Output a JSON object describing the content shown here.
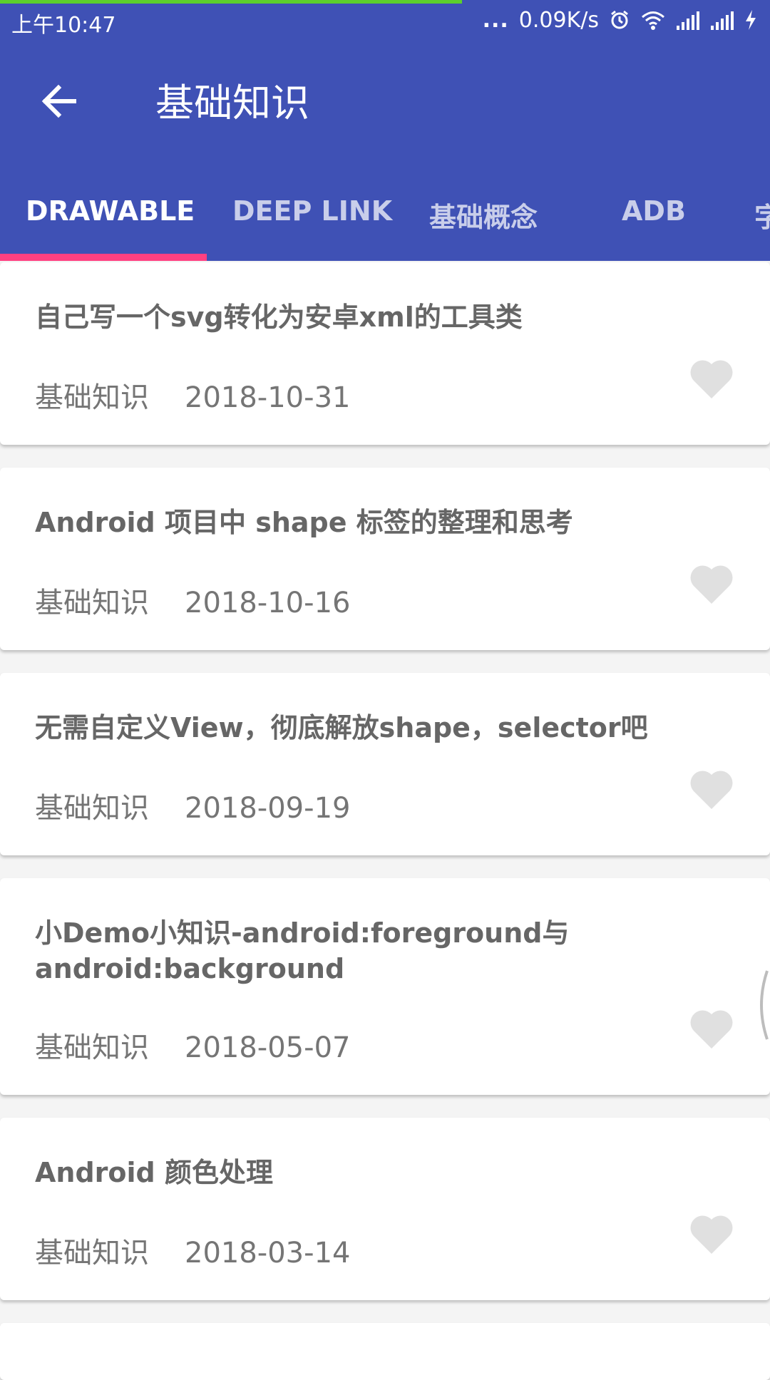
{
  "status_bar": {
    "time": "上午10:47",
    "more": "...",
    "network_speed": "0.09K/s",
    "page_load_progress": 0.6
  },
  "toolbar": {
    "back_icon": "arrow-back-icon",
    "title": "基础知识"
  },
  "tabs": [
    {
      "label": "DRAWABLE",
      "active": true
    },
    {
      "label": "DEEP LINK",
      "active": false
    },
    {
      "label": "基础概念",
      "active": false
    },
    {
      "label": "ADB",
      "active": false
    },
    {
      "label": "字",
      "active": false
    }
  ],
  "colors": {
    "primary": "#3f51b5",
    "accent": "#ff4081",
    "heart": "#e0e0e0"
  },
  "articles": [
    {
      "title": "自己写一个svg转化为安卓xml的工具类",
      "category": "基础知识",
      "date": "2018-10-31",
      "favorited": false
    },
    {
      "title": "Android 项目中 shape 标签的整理和思考",
      "category": "基础知识",
      "date": "2018-10-16",
      "favorited": false
    },
    {
      "title": "无需自定义View，彻底解放shape，selector吧",
      "category": "基础知识",
      "date": "2018-09-19",
      "favorited": false
    },
    {
      "title": "小Demo小知识-android:foreground与android:background",
      "category": "基础知识",
      "date": "2018-05-07",
      "favorited": false
    },
    {
      "title": "Android 颜色处理",
      "category": "基础知识",
      "date": "2018-03-14",
      "favorited": false
    }
  ]
}
